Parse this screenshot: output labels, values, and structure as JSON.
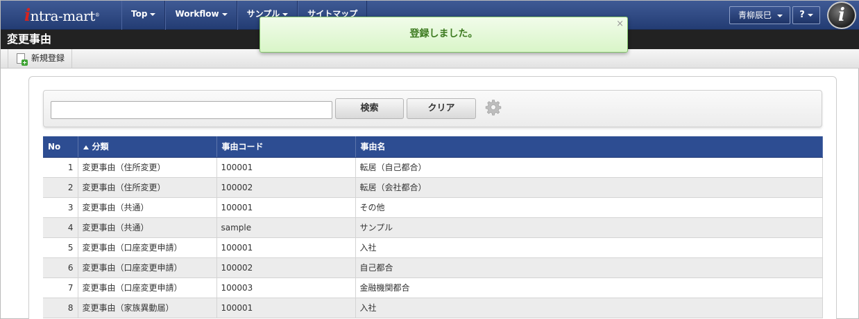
{
  "header": {
    "logo_text": "intra-mart",
    "nav": [
      {
        "label": "Top"
      },
      {
        "label": "Workflow"
      },
      {
        "label": "サンプル"
      },
      {
        "label": "サイトマップ"
      }
    ],
    "user_name": "青柳辰巳",
    "help_label": "?"
  },
  "page": {
    "title": "変更事由"
  },
  "toolbar": {
    "new_label": "新規登録"
  },
  "search": {
    "value": "",
    "search_label": "検索",
    "clear_label": "クリア"
  },
  "table": {
    "headers": {
      "no": "No",
      "category": "分類",
      "code": "事由コード",
      "name": "事由名"
    },
    "rows": [
      {
        "no": "1",
        "category": "変更事由（住所変更）",
        "code": "100001",
        "name": "転居（自己都合）"
      },
      {
        "no": "2",
        "category": "変更事由（住所変更）",
        "code": "100002",
        "name": "転居（会社都合）"
      },
      {
        "no": "3",
        "category": "変更事由（共通）",
        "code": "100001",
        "name": "その他"
      },
      {
        "no": "4",
        "category": "変更事由（共通）",
        "code": "sample",
        "name": "サンプル"
      },
      {
        "no": "5",
        "category": "変更事由（口座変更申請）",
        "code": "100001",
        "name": "入社"
      },
      {
        "no": "6",
        "category": "変更事由（口座変更申請）",
        "code": "100002",
        "name": "自己都合"
      },
      {
        "no": "7",
        "category": "変更事由（口座変更申請）",
        "code": "100003",
        "name": "金融機関都合"
      },
      {
        "no": "8",
        "category": "変更事由（家族異動届）",
        "code": "100001",
        "name": "入社"
      }
    ]
  },
  "toast": {
    "message": "登録しました。",
    "close_label": "×"
  },
  "colors": {
    "nav_bg": "#233c73",
    "table_header": "#2d4d92",
    "toast_text": "#3c7a1f"
  }
}
